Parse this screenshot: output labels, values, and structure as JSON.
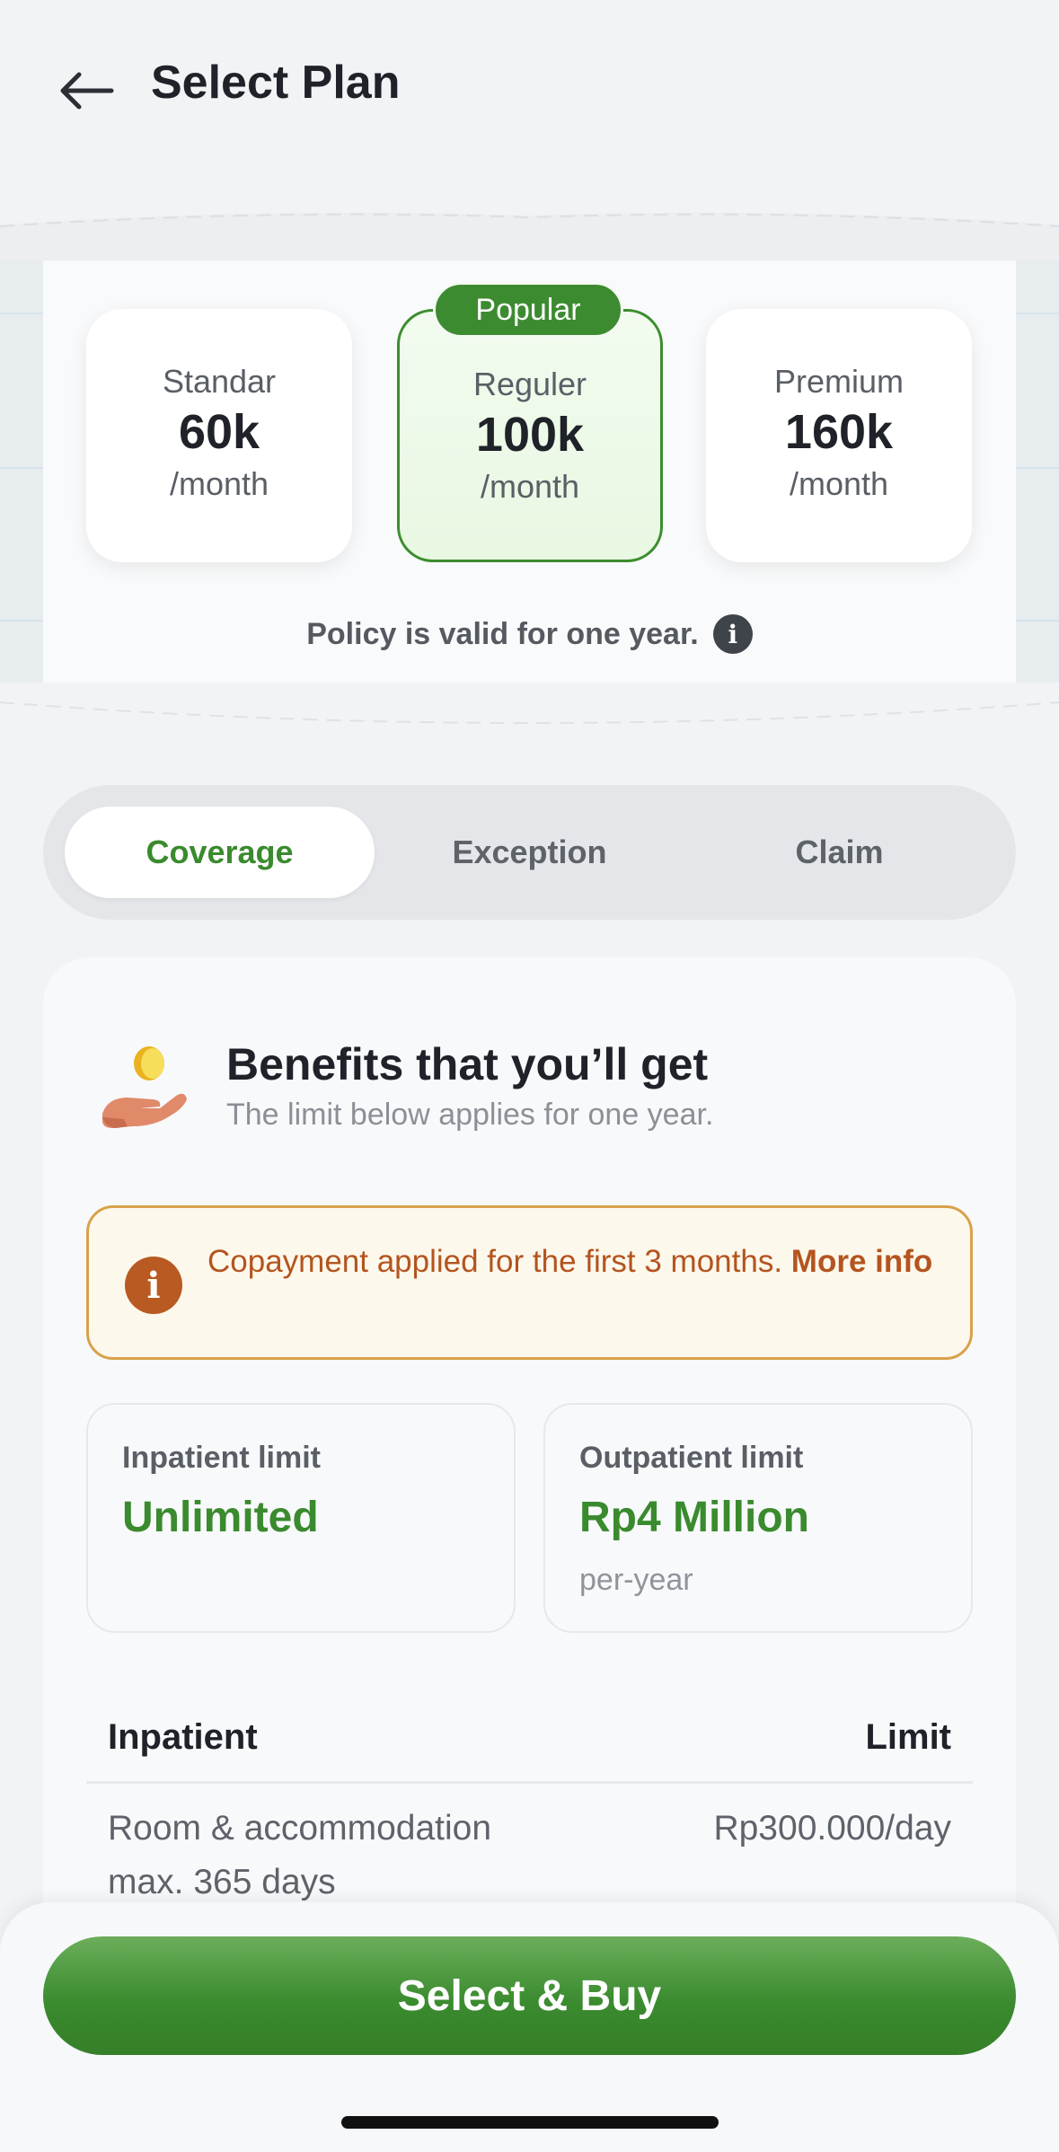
{
  "header": {
    "back_icon": "arrow-left-icon",
    "title": "Select Plan"
  },
  "plans": [
    {
      "name": "Standar",
      "price": "60k",
      "period": "/month",
      "selected": false
    },
    {
      "name": "Reguler",
      "price": "100k",
      "period": "/month",
      "selected": true
    },
    {
      "name": "Premium",
      "price": "160k",
      "period": "/month",
      "selected": false
    }
  ],
  "popular_badge": "Popular",
  "policy_note": "Policy is valid for one year.",
  "policy_info_icon": "info-icon",
  "tabs": [
    {
      "label": "Coverage",
      "active": true
    },
    {
      "label": "Exception",
      "active": false
    },
    {
      "label": "Claim",
      "active": false
    }
  ],
  "benefits": {
    "icon": "hand-coin-icon",
    "title": "Benefits that you’ll get",
    "subtitle": "The limit below applies for one year."
  },
  "copay": {
    "icon": "info-icon",
    "text": "Copayment applied for the first 3 months.",
    "link": "More info"
  },
  "limits": [
    {
      "label": "Inpatient limit",
      "value": "Unlimited",
      "sub": ""
    },
    {
      "label": "Outpatient limit",
      "value": "Rp4 Million",
      "sub": "per-year"
    }
  ],
  "table": {
    "col_left": "Inpatient",
    "col_right": "Limit",
    "rows": [
      {
        "item": "Room & accommodation max. 365 days",
        "limit": "Rp300.000/day"
      }
    ]
  },
  "cta": {
    "label": "Select & Buy"
  },
  "colors": {
    "accent": "#3a8a2e",
    "copay_text": "#b4541f",
    "copay_border": "#d8a24a"
  }
}
